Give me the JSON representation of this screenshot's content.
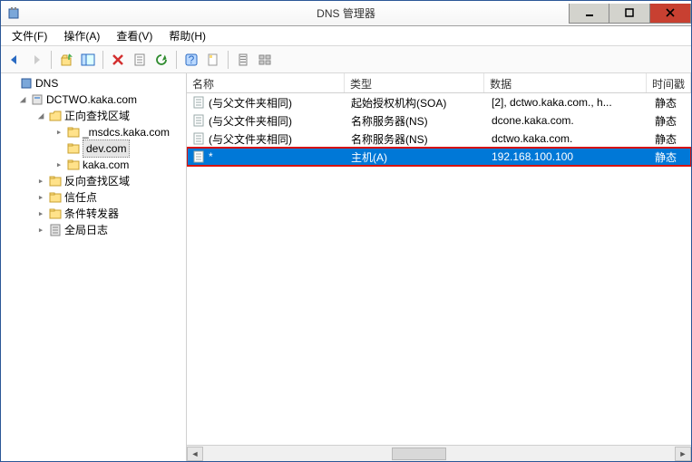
{
  "window": {
    "title": "DNS 管理器"
  },
  "menu": {
    "file": "文件(F)",
    "action": "操作(A)",
    "view": "查看(V)",
    "help": "帮助(H)"
  },
  "tree": {
    "root": "DNS",
    "server": "DCTWO.kaka.com",
    "fwd_zone": "正向查找区域",
    "msdcs": "_msdcs.kaka.com",
    "dev": "dev.com",
    "kaka": "kaka.com",
    "rev_zone": "反向查找区域",
    "trust": "信任点",
    "cond_fwd": "条件转发器",
    "global_log": "全局日志"
  },
  "columns": {
    "name": "名称",
    "type": "类型",
    "data": "数据",
    "timestamp": "时间戳"
  },
  "rows": [
    {
      "name": "(与父文件夹相同)",
      "type": "起始授权机构(SOA)",
      "data": "[2], dctwo.kaka.com., h...",
      "ts": "静态",
      "selected": false
    },
    {
      "name": "(与父文件夹相同)",
      "type": "名称服务器(NS)",
      "data": "dcone.kaka.com.",
      "ts": "静态",
      "selected": false
    },
    {
      "name": "(与父文件夹相同)",
      "type": "名称服务器(NS)",
      "data": "dctwo.kaka.com.",
      "ts": "静态",
      "selected": false
    },
    {
      "name": "*",
      "type": "主机(A)",
      "data": "192.168.100.100",
      "ts": "静态",
      "selected": true
    }
  ]
}
